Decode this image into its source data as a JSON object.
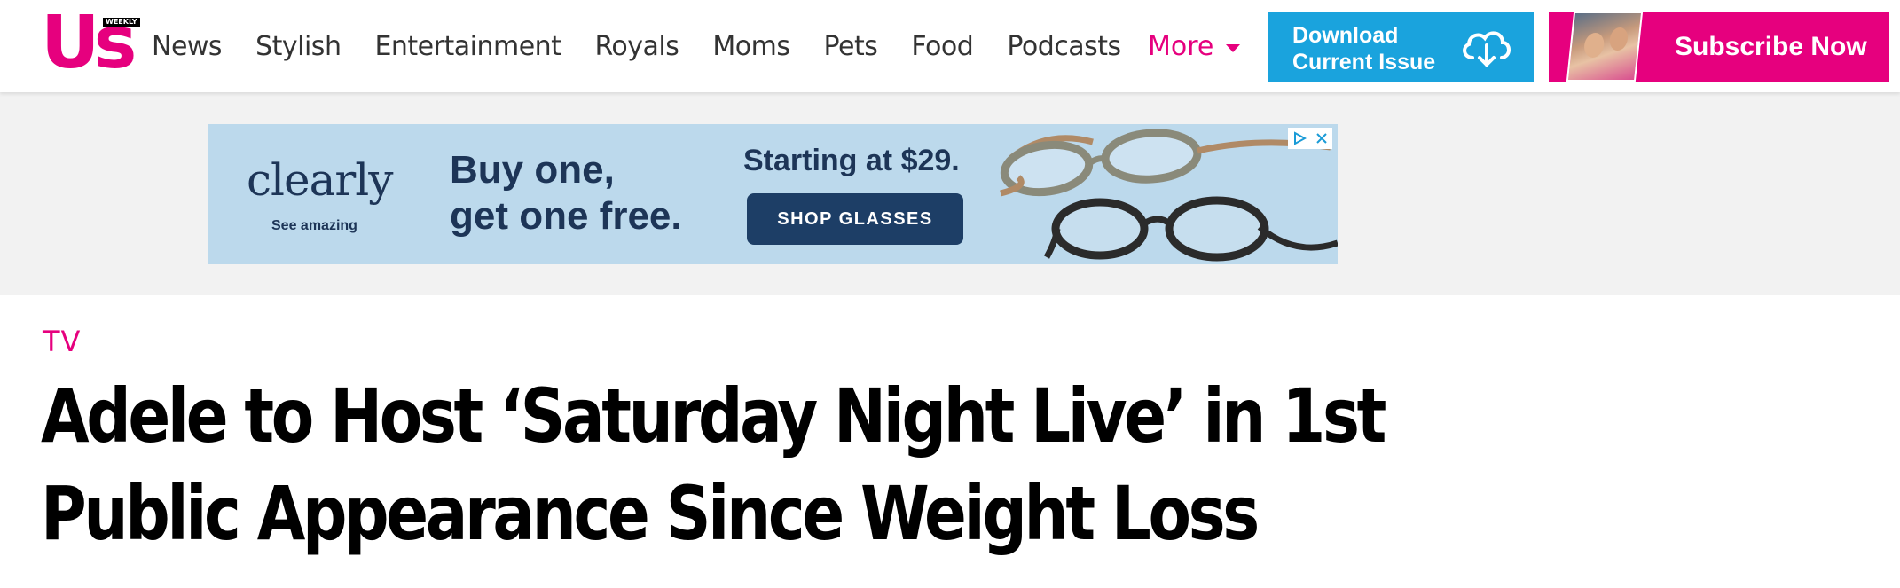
{
  "header": {
    "logo": {
      "main": "Us",
      "badge": "WEEKLY"
    },
    "nav": [
      "News",
      "Stylish",
      "Entertainment",
      "Royals",
      "Moms",
      "Pets",
      "Food",
      "Podcasts"
    ],
    "more_label": "More",
    "download": {
      "label": "Download\nCurrent Issue",
      "icon": "cloud-download-icon"
    },
    "subscribe": {
      "label": "Subscribe Now",
      "icon": "magazine-cover-thumbnail"
    }
  },
  "ad": {
    "brand": "clearly",
    "tagline": "See amazing",
    "headline": "Buy one,\nget one free.",
    "price": "Starting at $29.",
    "cta": "SHOP GLASSES",
    "icons": [
      "adchoices-icon",
      "close-icon"
    ]
  },
  "article": {
    "section": "TV",
    "title": "Adele to Host ‘Saturday Night Live’ in 1st Public Appearance Since Weight Loss"
  },
  "colors": {
    "brand_pink": "#e6007e",
    "download_blue": "#1aa3dd",
    "ad_background": "#bcd9ec",
    "ad_navy": "#1d3e66"
  }
}
